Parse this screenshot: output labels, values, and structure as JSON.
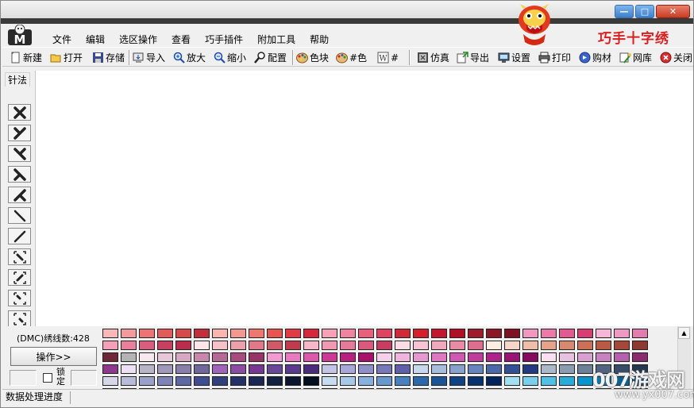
{
  "app": {
    "brand_text": "巧手十字绣",
    "logo_letter": "M"
  },
  "window_controls": {
    "minimize": "—",
    "maximize": "□",
    "close": "✕"
  },
  "menu": [
    "文件",
    "编辑",
    "选区操作",
    "查看",
    "巧手插件",
    "附加工具",
    "帮助"
  ],
  "toolbar": [
    {
      "label": "新建",
      "icon": "new-file-icon"
    },
    {
      "label": "打开",
      "icon": "open-folder-icon"
    },
    {
      "label": "存储",
      "icon": "save-disk-icon"
    },
    {
      "label": "导入",
      "icon": "import-icon"
    },
    {
      "label": "放大",
      "icon": "zoom-in-icon"
    },
    {
      "label": "缩小",
      "icon": "zoom-out-icon"
    },
    {
      "label": "配置",
      "icon": "config-magnifier-icon"
    },
    {
      "label": "色块",
      "icon": "color-block-palette-icon"
    },
    {
      "label": "#色",
      "icon": "color-symbol-palette-icon"
    },
    {
      "label": "#",
      "icon": "symbol-w-icon"
    },
    {
      "label": "仿真",
      "icon": "simulate-icon"
    },
    {
      "label": "导出",
      "icon": "export-icon"
    },
    {
      "label": "设置",
      "icon": "settings-icon"
    },
    {
      "label": "打印",
      "icon": "printer-icon"
    },
    {
      "label": "购材",
      "icon": "purchase-icon"
    },
    {
      "label": "网库",
      "icon": "web-library-icon"
    },
    {
      "label": "关闭",
      "icon": "close-circle-icon"
    }
  ],
  "stitch_panel": {
    "label": "针法",
    "tools": [
      "full-cross-stitch-icon",
      "half-stitch-left-icon",
      "half-stitch-right-icon",
      "quarter-stitch-a-icon",
      "quarter-stitch-b-icon",
      "backstitch-icon",
      "pen-stitch-icon",
      "select-corner-a-icon",
      "select-corner-b-icon",
      "select-corner-c-icon",
      "select-corner-d-icon"
    ]
  },
  "thread_info": {
    "label": "(DMC)绣线数:428"
  },
  "operate_button": "操作>>",
  "lock_label": "锁定",
  "status": {
    "text": "数据处理进度"
  },
  "watermark": {
    "main": "007游戏网",
    "sub": "www.yx007.com"
  },
  "palette": {
    "rows": [
      [
        "#f9b8b8",
        "#f49a9a",
        "#ee7474",
        "#e45a5a",
        "#d64a4a",
        "#c42e3a",
        "#f8b6ae",
        "#f29890",
        "#ee7870",
        "#e8554f",
        "#e03c46",
        "#d8263a",
        "#f7a1b6",
        "#f084a0",
        "#e9607f",
        "#e04260",
        "#d02a38",
        "#d61e2c",
        "#c41630",
        "#b20e24",
        "#9e1a2c",
        "#8c1628",
        "#7c1222",
        "#f298c0",
        "#ec7aa8",
        "#e45a90",
        "#d83e72",
        "#f7b6d8",
        "#f098c4",
        "#e47cb0"
      ],
      [
        "#f4a0b8",
        "#e8809c",
        "#d85e7e",
        "#c84060",
        "#b82e4c",
        "#fbe6ea",
        "#f4c2c8",
        "#eca0aa",
        "#e07a88",
        "#d05a68",
        "#c03c4c",
        "#f6b8c8",
        "#f09ab2",
        "#e67a98",
        "#da5a7e",
        "#c83e62",
        "#fadce4",
        "#f6c4d2",
        "#f0a8bc",
        "#e88ca6",
        "#de6e8e",
        "#fbeee2",
        "#f6d6c6",
        "#eebea8",
        "#e4a48a",
        "#d88a70",
        "#cc7058",
        "#b85a44",
        "#a4483a",
        "#8e3a30"
      ],
      [
        "#702838",
        "#b4b4b4",
        "#f6e8ee",
        "#e8c8d8",
        "#d8a8c2",
        "#c888ac",
        "#b86896",
        "#a84c80",
        "#983466",
        "#f49ad2",
        "#e87ac0",
        "#dc58ac",
        "#cc3a96",
        "#ba2080",
        "#a8106c",
        "#f6d0ea",
        "#f0b4de",
        "#e898d0",
        "#de78c2",
        "#d058b2",
        "#c03c9e",
        "#ae248a",
        "#9a1476",
        "#860a60",
        "#f8e0f0",
        "#e8c0e0",
        "#d8a0d0",
        "#c880c0",
        "#b860b0",
        "#8c2a70"
      ],
      [
        "#8e3a8c",
        "#ece0f4",
        "#b8b4c8",
        "#a098b8",
        "#8880a8",
        "#706898",
        "#a064b8",
        "#8c4ca4",
        "#763890",
        "#6a4898",
        "#5a3a8a",
        "#4a2c7c",
        "#c4c4e6",
        "#a8a8d8",
        "#9090c8",
        "#7878b8",
        "#6060a8",
        "#c8d8ec",
        "#a8bcdc",
        "#88a0cc",
        "#6884bc",
        "#4c68a8",
        "#345094",
        "#243a80",
        "#aab8c8",
        "#8a9cb0",
        "#6c8098",
        "#506480",
        "#384c68",
        "#243850"
      ],
      [
        "#d6d8e8",
        "#b8bcd8",
        "#9aa0c8",
        "#7c84b8",
        "#5e68a4",
        "#404c90",
        "#30407c",
        "#243268",
        "#1c2854",
        "#142040",
        "#0c162e",
        "#041020",
        "#c8dcf0",
        "#a8c8e8",
        "#88b0dc",
        "#6898d0",
        "#4880c0",
        "#2c68ac",
        "#1c5498",
        "#104284",
        "#083270",
        "#04245c",
        "#a0e0f0",
        "#78d0ec",
        "#50c0e4",
        "#28acdc",
        "#0894cc",
        "#047cb4",
        "#04649c",
        "#044c84"
      ],
      [
        "#dcecf4",
        "#b8dce8",
        "#94c8dc",
        "#70b4d0",
        "#4ca0c4",
        "#2c8cb8",
        "#1478a4",
        "#086490",
        "#04507c",
        "#043c68",
        "#d0f0e8",
        "#a8e4d8",
        "#80d8c8",
        "#58ccb8",
        "#30c0a8",
        "#10b098",
        "#08a088",
        "#049078",
        "#047c68",
        "#046858",
        "#045448",
        "#c8f0c8",
        "#a0e4a0",
        "#78d878",
        "#50cc50",
        "#30bc30",
        "#18a818",
        "#0c9410",
        "#08800c",
        "#046c08"
      ]
    ]
  }
}
